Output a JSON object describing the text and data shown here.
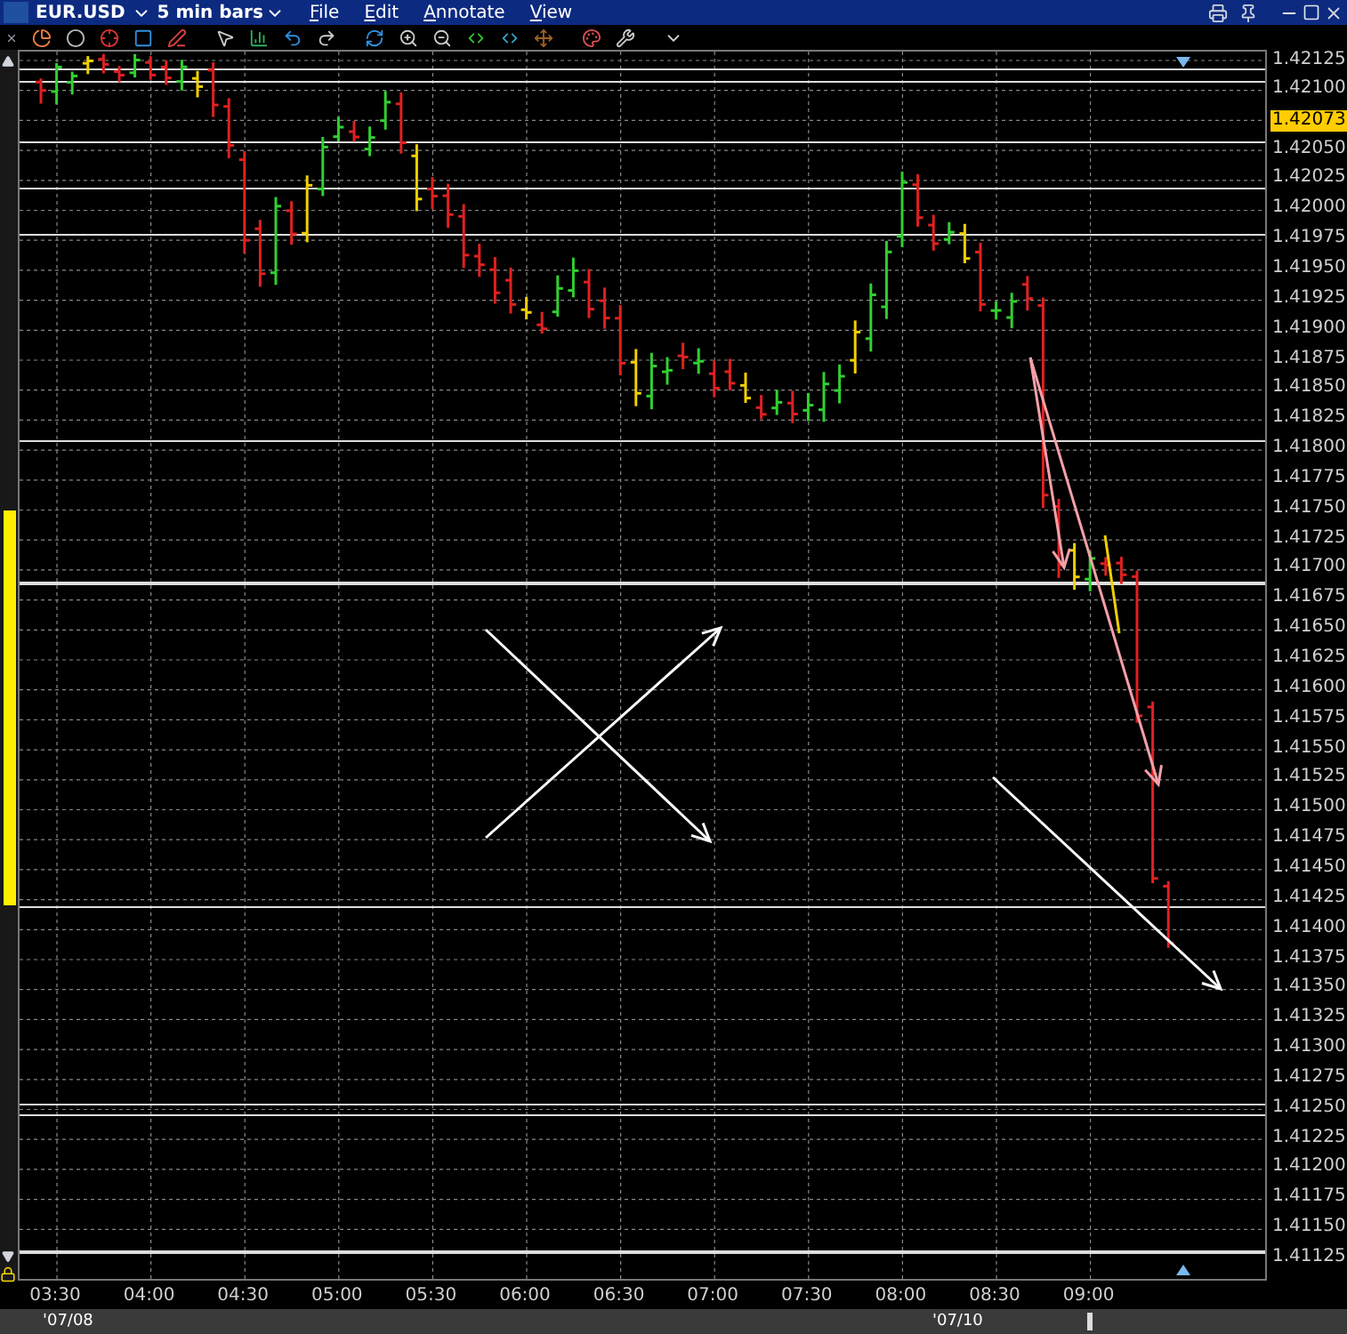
{
  "window": {
    "symbol": "EUR.USD",
    "bar_size": "5 min bars",
    "menu": [
      "File",
      "Edit",
      "Annotate",
      "View"
    ]
  },
  "chart": {
    "last_price": "1.42073",
    "price_labels": [
      "1.42125",
      "1.42100",
      "1.42050",
      "1.42025",
      "1.42000",
      "1.41975",
      "1.41950",
      "1.41925",
      "1.41900",
      "1.41875",
      "1.41850",
      "1.41825",
      "1.41800",
      "1.41775",
      "1.41750",
      "1.41725",
      "1.41700",
      "1.41675",
      "1.41650",
      "1.41625",
      "1.41600",
      "1.41575",
      "1.41550",
      "1.41525",
      "1.41500",
      "1.41475",
      "1.41450",
      "1.41425",
      "1.41400",
      "1.41375",
      "1.41350",
      "1.41325",
      "1.41300",
      "1.41275",
      "1.41250",
      "1.41225",
      "1.41200",
      "1.41175",
      "1.41150",
      "1.41125"
    ],
    "time_labels": [
      "03:30",
      "04:00",
      "04:30",
      "05:00",
      "05:30",
      "06:00",
      "06:30",
      "07:00",
      "07:30",
      "08:00",
      "08:30",
      "09:00"
    ],
    "date_labels": [
      "'07/08",
      "'07/10"
    ]
  }
}
